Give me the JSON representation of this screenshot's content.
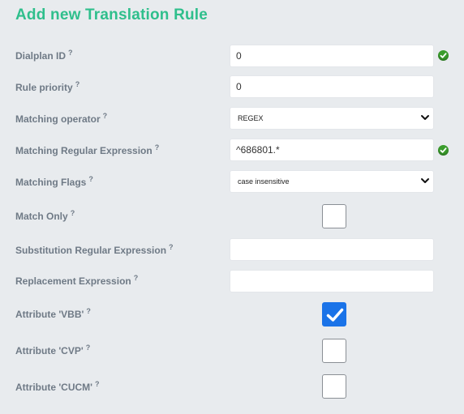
{
  "title": "Add new Translation Rule",
  "help_mark": "?",
  "fields": {
    "dialplan_id": {
      "label": "Dialplan ID",
      "value": "0",
      "valid": true
    },
    "rule_priority": {
      "label": "Rule priority",
      "value": "0"
    },
    "matching_operator": {
      "label": "Matching operator",
      "value": "REGEX"
    },
    "matching_regex": {
      "label": "Matching Regular Expression",
      "value": "^686801.*",
      "valid": true
    },
    "matching_flags": {
      "label": "Matching Flags",
      "value": "case insensitive"
    },
    "match_only": {
      "label": "Match Only",
      "checked": false
    },
    "substitution_regex": {
      "label": "Substitution Regular Expression",
      "value": ""
    },
    "replacement_expression": {
      "label": "Replacement Expression",
      "value": ""
    },
    "attr_vbb": {
      "label": "Attribute 'VBB'",
      "checked": true
    },
    "attr_cvp": {
      "label": "Attribute 'CVP'",
      "checked": false
    },
    "attr_cucm": {
      "label": "Attribute 'CUCM'",
      "checked": false
    }
  },
  "colors": {
    "title": "#2fbf8c",
    "label": "#6f7a86",
    "background": "#e8ebee",
    "checkbox_checked": "#1a73e8",
    "valid_icon": "#3a9d2c"
  },
  "icons": {
    "valid": "check-circle-icon",
    "dropdown": "chevron-down-icon",
    "checkmark": "checkmark-icon"
  }
}
